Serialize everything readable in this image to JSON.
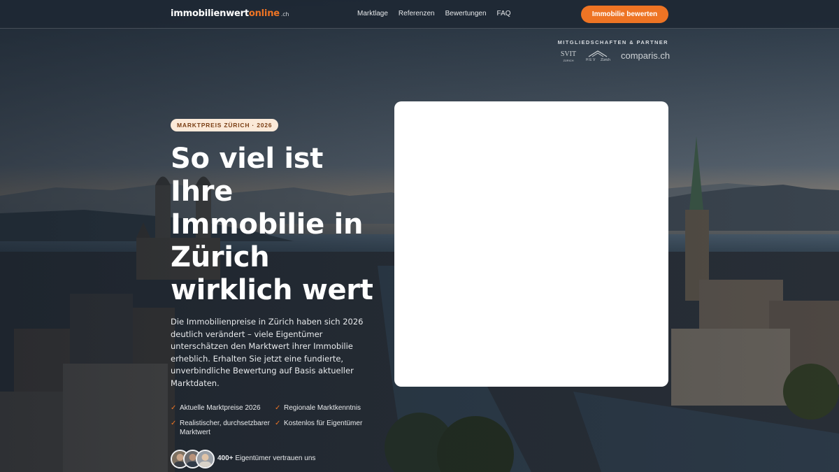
{
  "header": {
    "logo": {
      "main": "immobilienwert",
      "accent": "online",
      "tld": ".ch"
    },
    "nav": [
      {
        "label": "Marktlage"
      },
      {
        "label": "Referenzen"
      },
      {
        "label": "Bewertungen"
      },
      {
        "label": "FAQ"
      }
    ],
    "cta_label": "Immobilie bewerten"
  },
  "partners": {
    "title": "MITGLIEDSCHAFTEN & PARTNER",
    "logos": {
      "svit": {
        "name": "SVIT",
        "sub": "ZÜRICH"
      },
      "hev": {
        "name": "HEV",
        "sub": "Zürich"
      },
      "comparis": "comparis.ch"
    }
  },
  "hero": {
    "badge": "MARKTPREIS ZÜRICH · 2026",
    "headline": "So viel ist Ihre Immobilie in Zürich wirklich wert",
    "lead": "Die Immobilienpreise in Zürich haben sich 2026 deutlich verändert – viele Eigentümer unterschätzen den Marktwert ihrer Immobilie erheblich. Erhalten Sie jetzt eine fundierte, unverbindliche Bewertung auf Basis aktueller Marktdaten.",
    "check_symbol": "✓",
    "features": [
      "Aktuelle Marktpreise 2026",
      "Regionale Marktkenntnis",
      "Realistischer, durchsetzbarer Marktwert",
      "Kostenlos für Eigentümer"
    ],
    "trust": {
      "count": "400+",
      "text": "Eigentümer vertrauen uns"
    }
  },
  "colors": {
    "accent": "#ee7424",
    "header_bg": "#1e2834",
    "badge_bg": "#fbe9d8",
    "card_bg": "#ffffff"
  },
  "icons": {
    "check": "check-icon",
    "avatar": "avatar-icon"
  }
}
